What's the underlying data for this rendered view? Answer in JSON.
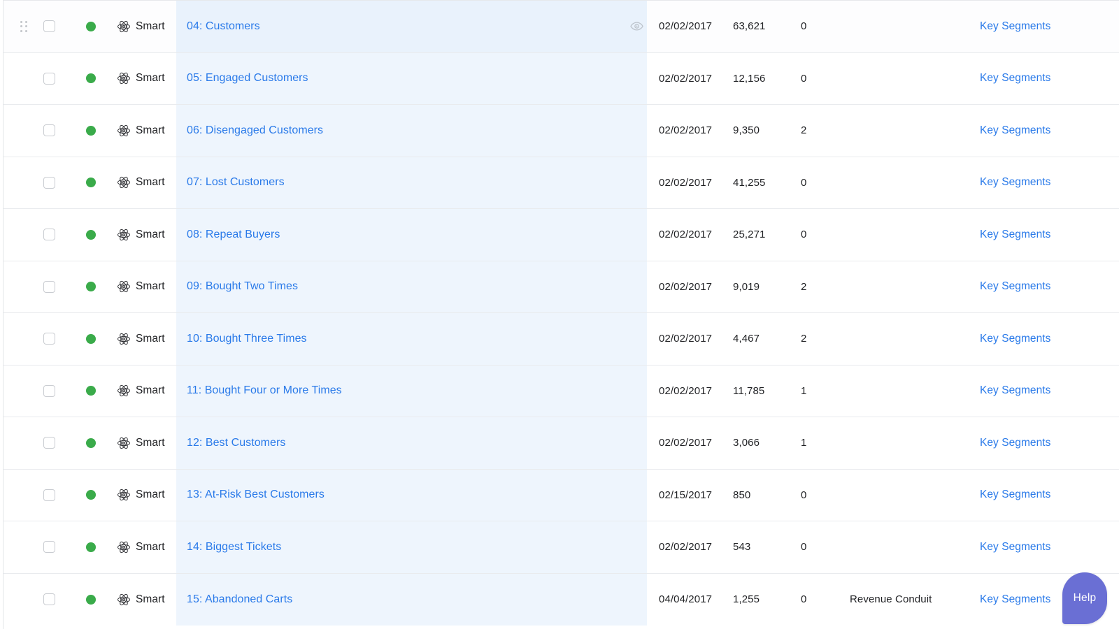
{
  "colors": {
    "link_blue": "#2a7ae9",
    "status_green": "#3aab4a",
    "name_band": "#eef5fd",
    "help_purple": "#6a6fd4",
    "row_border": "#e9ebee",
    "text": "#1f2023"
  },
  "table": {
    "columns": [
      "drag",
      "select",
      "status",
      "type",
      "name",
      "preview",
      "date",
      "count",
      "number",
      "source",
      "actions"
    ],
    "type_label": "Smart",
    "action_label": "Key Segments",
    "rows": [
      {
        "name": "04: Customers",
        "type": "Smart",
        "date": "02/02/2017",
        "count": "63,621",
        "number": "0",
        "source": "",
        "action": "Key Segments",
        "hovered": true,
        "has_drag_handle": true,
        "has_preview_icon": true
      },
      {
        "name": "05: Engaged Customers",
        "type": "Smart",
        "date": "02/02/2017",
        "count": "12,156",
        "number": "0",
        "source": "",
        "action": "Key Segments",
        "hovered": false,
        "has_drag_handle": false,
        "has_preview_icon": false
      },
      {
        "name": "06: Disengaged Customers",
        "type": "Smart",
        "date": "02/02/2017",
        "count": "9,350",
        "number": "2",
        "source": "",
        "action": "Key Segments",
        "hovered": false,
        "has_drag_handle": false,
        "has_preview_icon": false
      },
      {
        "name": "07: Lost Customers",
        "type": "Smart",
        "date": "02/02/2017",
        "count": "41,255",
        "number": "0",
        "source": "",
        "action": "Key Segments",
        "hovered": false,
        "has_drag_handle": false,
        "has_preview_icon": false
      },
      {
        "name": "08: Repeat Buyers",
        "type": "Smart",
        "date": "02/02/2017",
        "count": "25,271",
        "number": "0",
        "source": "",
        "action": "Key Segments",
        "hovered": false,
        "has_drag_handle": false,
        "has_preview_icon": false
      },
      {
        "name": "09: Bought Two Times",
        "type": "Smart",
        "date": "02/02/2017",
        "count": "9,019",
        "number": "2",
        "source": "",
        "action": "Key Segments",
        "hovered": false,
        "has_drag_handle": false,
        "has_preview_icon": false
      },
      {
        "name": "10: Bought Three Times",
        "type": "Smart",
        "date": "02/02/2017",
        "count": "4,467",
        "number": "2",
        "source": "",
        "action": "Key Segments",
        "hovered": false,
        "has_drag_handle": false,
        "has_preview_icon": false
      },
      {
        "name": "11: Bought Four or More Times",
        "type": "Smart",
        "date": "02/02/2017",
        "count": "11,785",
        "number": "1",
        "source": "",
        "action": "Key Segments",
        "hovered": false,
        "has_drag_handle": false,
        "has_preview_icon": false
      },
      {
        "name": "12: Best Customers",
        "type": "Smart",
        "date": "02/02/2017",
        "count": "3,066",
        "number": "1",
        "source": "",
        "action": "Key Segments",
        "hovered": false,
        "has_drag_handle": false,
        "has_preview_icon": false
      },
      {
        "name": "13: At-Risk Best Customers",
        "type": "Smart",
        "date": "02/15/2017",
        "count": "850",
        "number": "0",
        "source": "",
        "action": "Key Segments",
        "hovered": false,
        "has_drag_handle": false,
        "has_preview_icon": false
      },
      {
        "name": "14: Biggest Tickets",
        "type": "Smart",
        "date": "02/02/2017",
        "count": "543",
        "number": "0",
        "source": "",
        "action": "Key Segments",
        "hovered": false,
        "has_drag_handle": false,
        "has_preview_icon": false
      },
      {
        "name": "15: Abandoned Carts",
        "type": "Smart",
        "date": "04/04/2017",
        "count": "1,255",
        "number": "0",
        "source": "Revenue Conduit",
        "action": "Key Segments",
        "hovered": false,
        "has_drag_handle": false,
        "has_preview_icon": false
      }
    ]
  },
  "help_widget": {
    "label": "Help"
  },
  "icons": {
    "drag": "drag-handle-icon",
    "checkbox": "checkbox-icon",
    "status": "status-dot-icon",
    "type": "atom-icon",
    "preview": "eye-icon"
  }
}
